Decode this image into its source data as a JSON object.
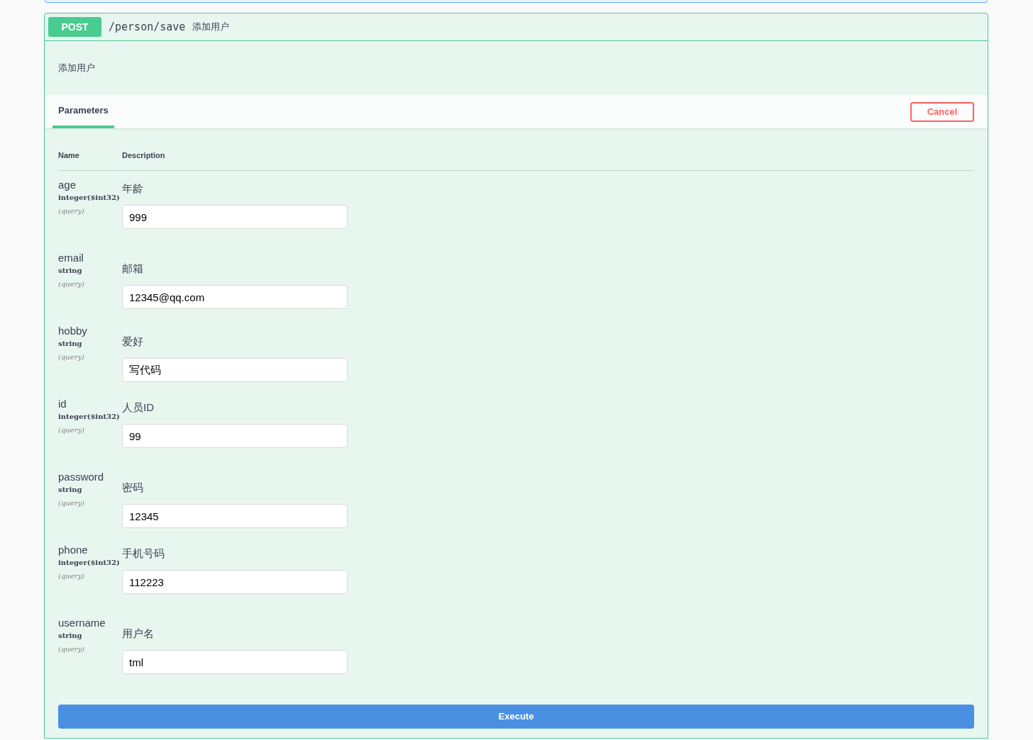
{
  "operation": {
    "method": "POST",
    "path": "/person/save",
    "summary": "添加用户",
    "description": "添加用户"
  },
  "tabs": [
    {
      "label": "Parameters",
      "selected": true
    }
  ],
  "cancel_button": "Cancel",
  "table": {
    "columns": [
      "Name",
      "Description"
    ],
    "rows": [
      {
        "name": "age",
        "type": "integer",
        "format": "($int32)",
        "location": "(query)",
        "description": "年龄",
        "value": "999"
      },
      {
        "name": "email",
        "type": "string",
        "location": "(query)",
        "description": "邮箱",
        "value": "12345@qq.com"
      },
      {
        "name": "hobby",
        "type": "string",
        "location": "(query)",
        "description": "爱好",
        "value": "写代码"
      },
      {
        "name": "id",
        "type": "integer",
        "format": "($int32)",
        "location": "(query)",
        "description": "人员ID",
        "value": "99"
      },
      {
        "name": "password",
        "type": "string",
        "location": "(query)",
        "description": "密码",
        "value": "12345"
      },
      {
        "name": "phone",
        "type": "integer",
        "format": "($int32)",
        "location": "(query)",
        "description": "手机号码",
        "value": "112223"
      },
      {
        "name": "username",
        "type": "string",
        "location": "(query)",
        "description": "用户名",
        "value": "tml"
      }
    ]
  },
  "execute_button": "Execute"
}
